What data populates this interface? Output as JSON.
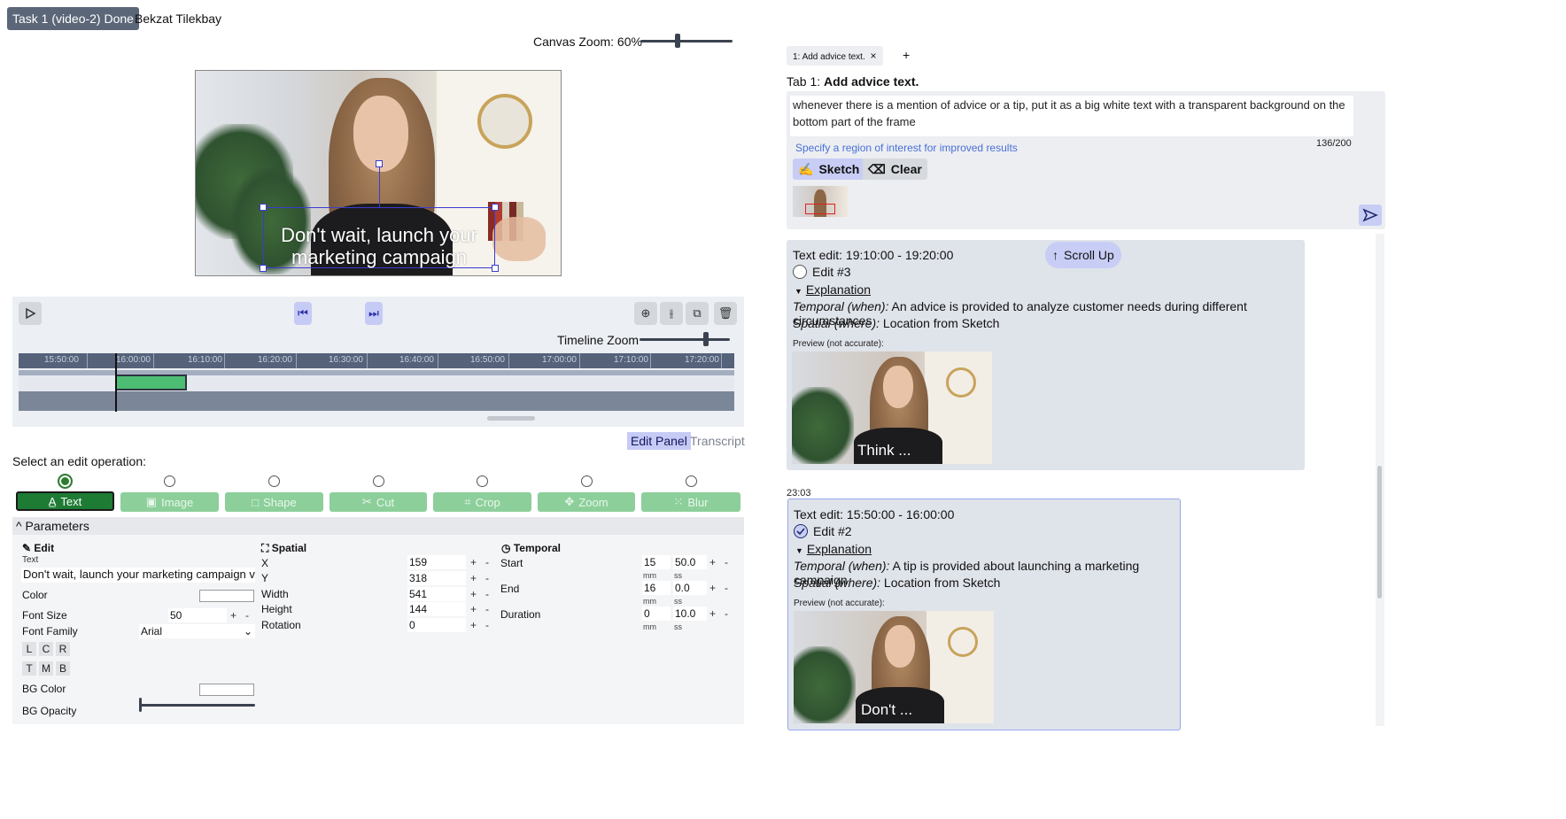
{
  "header": {
    "task_badge": "Task 1 (video-2) Done",
    "user_name": "Bekzat Tilekbay"
  },
  "canvas": {
    "zoom_label": "Canvas Zoom: 60%",
    "zoom_percent": 60,
    "overlay_text_line1": "Don't wait, launch your",
    "overlay_text_line2": "marketing campaign"
  },
  "timeline": {
    "zoom_label": "Timeline Zoom",
    "ticks": [
      "15:50:00",
      "16:00:00",
      "16:10:00",
      "16:20:00",
      "16:30:00",
      "16:40:00",
      "16:50:00",
      "17:00:00",
      "17:10:00",
      "17:20:00"
    ]
  },
  "panel_tabs": {
    "edit_panel": "Edit Panel",
    "transcript": "Transcript"
  },
  "operations": {
    "prompt": "Select an edit operation:",
    "items": [
      {
        "label": "Text",
        "icon": "text-icon",
        "selected": true
      },
      {
        "label": "Image",
        "icon": "image-icon",
        "selected": false
      },
      {
        "label": "Shape",
        "icon": "shape-icon",
        "selected": false
      },
      {
        "label": "Cut",
        "icon": "scissors-icon",
        "selected": false
      },
      {
        "label": "Crop",
        "icon": "crop-icon",
        "selected": false
      },
      {
        "label": "Zoom",
        "icon": "zoom-icon",
        "selected": false
      },
      {
        "label": "Blur",
        "icon": "blur-icon",
        "selected": false
      }
    ]
  },
  "params": {
    "title": "Parameters",
    "edit": {
      "title": "Edit",
      "text_label": "Text",
      "text_value": "Don't wait, launch your marketing campaign v",
      "color_label": "Color",
      "font_size_label": "Font Size",
      "font_size_value": "50",
      "font_family_label": "Font Family",
      "font_family_value": "Arial",
      "h_align": [
        "L",
        "C",
        "R"
      ],
      "v_align": [
        "T",
        "M",
        "B"
      ],
      "bg_color_label": "BG Color",
      "bg_opacity_label": "BG Opacity"
    },
    "spatial": {
      "title": "Spatial",
      "x_label": "X",
      "x_value": "159",
      "y_label": "Y",
      "y_value": "318",
      "width_label": "Width",
      "width_value": "541",
      "height_label": "Height",
      "height_value": "144",
      "rotation_label": "Rotation",
      "rotation_value": "0"
    },
    "temporal": {
      "title": "Temporal",
      "start_label": "Start",
      "start_mm": "15",
      "start_ss": "50.0",
      "end_label": "End",
      "end_mm": "16",
      "end_ss": "0.0",
      "duration_label": "Duration",
      "duration_mm": "0",
      "duration_ss": "10.0",
      "mm": "mm",
      "ss": "ss"
    },
    "plus": "+",
    "minus": "-"
  },
  "right": {
    "tab_chip": "1: Add advice text.",
    "tab_close": "×",
    "tab_plus": "+",
    "tab_title_prefix": "Tab 1: ",
    "tab_title_bold": "Add advice text.",
    "prompt_text": "whenever there is a mention of advice or a tip, put it as a big white text with a transparent background on the bottom part of the frame",
    "region_link": "Specify a region of interest for improved results",
    "counter": "136/200",
    "sketch": "Sketch",
    "clear": "Clear",
    "scroll_up": "Scroll Up",
    "timestamp": "23:03",
    "edits": [
      {
        "range": "Text edit: 19:10:00 - 19:20:00",
        "name": "Edit #3",
        "checked": false,
        "explanation": "Explanation",
        "temporal_label": "Temporal (when):",
        "temporal_text": " An advice is provided to analyze customer needs during different circumstances",
        "spatial_label": "Spatial (where):",
        "spatial_text": " Location from Sketch",
        "preview_label": "Preview (not accurate):",
        "preview_caption": "Think ..."
      },
      {
        "range": "Text edit: 15:50:00 - 16:00:00",
        "name": "Edit #2",
        "checked": true,
        "explanation": "Explanation",
        "temporal_label": "Temporal (when):",
        "temporal_text": " A tip is provided about launching a marketing campaign",
        "spatial_label": "Spatial (where):",
        "spatial_text": " Location from Sketch",
        "preview_label": "Preview (not accurate):",
        "preview_caption": "Don't ..."
      }
    ]
  }
}
